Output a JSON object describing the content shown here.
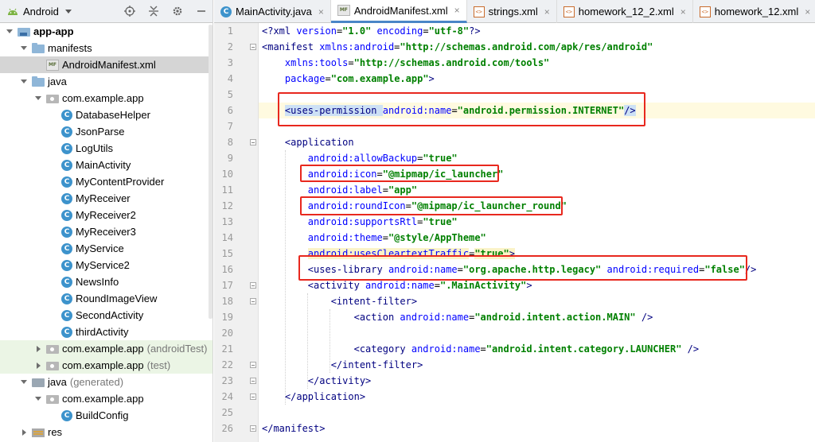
{
  "sidebar": {
    "view_label": "Android",
    "tree": [
      {
        "label": "app-app",
        "bold": true,
        "indent": 0,
        "arrow": "down",
        "icon": "module-folder-icon"
      },
      {
        "label": "manifests",
        "indent": 1,
        "arrow": "down",
        "icon": "folder-icon"
      },
      {
        "label": "AndroidManifest.xml",
        "indent": 2,
        "arrow": "none",
        "icon": "manifest-file-icon",
        "selected": true
      },
      {
        "label": "java",
        "indent": 1,
        "arrow": "down",
        "icon": "folder-icon"
      },
      {
        "label": "com.example.app",
        "indent": 2,
        "arrow": "down",
        "icon": "package-icon"
      },
      {
        "label": "DatabaseHelper",
        "indent": 3,
        "arrow": "none",
        "icon": "class-icon"
      },
      {
        "label": "JsonParse",
        "indent": 3,
        "arrow": "none",
        "icon": "class-icon"
      },
      {
        "label": "LogUtils",
        "indent": 3,
        "arrow": "none",
        "icon": "class-icon"
      },
      {
        "label": "MainActivity",
        "indent": 3,
        "arrow": "none",
        "icon": "class-icon"
      },
      {
        "label": "MyContentProvider",
        "indent": 3,
        "arrow": "none",
        "icon": "class-icon"
      },
      {
        "label": "MyReceiver",
        "indent": 3,
        "arrow": "none",
        "icon": "class-icon"
      },
      {
        "label": "MyReceiver2",
        "indent": 3,
        "arrow": "none",
        "icon": "class-icon"
      },
      {
        "label": "MyReceiver3",
        "indent": 3,
        "arrow": "none",
        "icon": "class-icon"
      },
      {
        "label": "MyService",
        "indent": 3,
        "arrow": "none",
        "icon": "class-icon"
      },
      {
        "label": "MyService2",
        "indent": 3,
        "arrow": "none",
        "icon": "class-icon"
      },
      {
        "label": "NewsInfo",
        "indent": 3,
        "arrow": "none",
        "icon": "class-icon"
      },
      {
        "label": "RoundImageView",
        "indent": 3,
        "arrow": "none",
        "icon": "class-icon"
      },
      {
        "label": "SecondActivity",
        "indent": 3,
        "arrow": "none",
        "icon": "class-icon"
      },
      {
        "label": "thirdActivity",
        "indent": 3,
        "arrow": "none",
        "icon": "class-icon"
      },
      {
        "label": "com.example.app",
        "suffix": "(androidTest)",
        "indent": 2,
        "arrow": "right",
        "icon": "package-icon",
        "green": true
      },
      {
        "label": "com.example.app",
        "suffix": "(test)",
        "indent": 2,
        "arrow": "right",
        "icon": "package-icon",
        "green": true
      },
      {
        "label": "java",
        "suffix": "(generated)",
        "indent": 1,
        "arrow": "down",
        "icon": "generated-folder-icon"
      },
      {
        "label": "com.example.app",
        "indent": 2,
        "arrow": "down",
        "icon": "package-icon"
      },
      {
        "label": "BuildConfig",
        "indent": 3,
        "arrow": "none",
        "icon": "class-icon"
      },
      {
        "label": "res",
        "indent": 1,
        "arrow": "right",
        "icon": "res-folder-icon"
      }
    ]
  },
  "tabs": [
    {
      "label": "MainActivity.java",
      "icon": "class-icon",
      "active": false
    },
    {
      "label": "AndroidManifest.xml",
      "icon": "manifest-file-icon",
      "active": true
    },
    {
      "label": "strings.xml",
      "icon": "xml-file-icon",
      "active": false
    },
    {
      "label": "homework_12_2.xml",
      "icon": "xml-file-icon",
      "active": false
    },
    {
      "label": "homework_12.xml",
      "icon": "xml-file-icon",
      "active": false
    }
  ],
  "editor": {
    "lines": [
      {
        "n": "1",
        "segs": [
          [
            "t",
            "<?xml "
          ],
          [
            "a",
            "version"
          ],
          [
            "p",
            "="
          ],
          [
            "v",
            "\"1.0\""
          ],
          [
            "p",
            " "
          ],
          [
            "a",
            "encoding"
          ],
          [
            "p",
            "="
          ],
          [
            "v",
            "\"utf-8\""
          ],
          [
            "t",
            "?>"
          ]
        ]
      },
      {
        "n": "2",
        "segs": [
          [
            "t",
            "<manifest "
          ],
          [
            "a",
            "xmlns:android"
          ],
          [
            "p",
            "="
          ],
          [
            "v",
            "\"http://schemas.android.com/apk/res/android\""
          ]
        ]
      },
      {
        "n": "3",
        "segs": [
          [
            "p",
            "    "
          ],
          [
            "a",
            "xmlns:tools"
          ],
          [
            "p",
            "="
          ],
          [
            "v",
            "\"http://schemas.android.com/tools\""
          ]
        ]
      },
      {
        "n": "4",
        "segs": [
          [
            "p",
            "    "
          ],
          [
            "a",
            "package"
          ],
          [
            "p",
            "="
          ],
          [
            "v",
            "\"com.example.app\""
          ],
          [
            "t",
            ">"
          ]
        ]
      },
      {
        "n": "5",
        "segs": []
      },
      {
        "n": "6",
        "segs": [
          [
            "p",
            "    "
          ],
          [
            "t",
            "<uses-permission "
          ],
          [
            "a",
            "android:name"
          ],
          [
            "p",
            "="
          ],
          [
            "v",
            "\"android.permission.INTERNET\""
          ],
          [
            "t",
            "/>"
          ]
        ]
      },
      {
        "n": "7",
        "segs": []
      },
      {
        "n": "8",
        "segs": [
          [
            "p",
            "    "
          ],
          [
            "t",
            "<application"
          ]
        ]
      },
      {
        "n": "9",
        "segs": [
          [
            "p",
            "        "
          ],
          [
            "a",
            "android:allowBackup"
          ],
          [
            "p",
            "="
          ],
          [
            "v",
            "\"true\""
          ]
        ]
      },
      {
        "n": "10",
        "segs": [
          [
            "p",
            "        "
          ],
          [
            "a",
            "android:icon"
          ],
          [
            "p",
            "="
          ],
          [
            "v",
            "\"@mipmap/ic_launcher\""
          ]
        ]
      },
      {
        "n": "11",
        "segs": [
          [
            "p",
            "        "
          ],
          [
            "a",
            "android:label"
          ],
          [
            "p",
            "="
          ],
          [
            "v",
            "\"app\""
          ]
        ]
      },
      {
        "n": "12",
        "segs": [
          [
            "p",
            "        "
          ],
          [
            "a",
            "android:roundIcon"
          ],
          [
            "p",
            "="
          ],
          [
            "v",
            "\"@mipmap/ic_launcher_round\""
          ]
        ]
      },
      {
        "n": "13",
        "segs": [
          [
            "p",
            "        "
          ],
          [
            "a",
            "android:supportsRtl"
          ],
          [
            "p",
            "="
          ],
          [
            "v",
            "\"true\""
          ]
        ]
      },
      {
        "n": "14",
        "segs": [
          [
            "p",
            "        "
          ],
          [
            "a",
            "android:theme"
          ],
          [
            "p",
            "="
          ],
          [
            "v",
            "\"@style/AppTheme\""
          ]
        ]
      },
      {
        "n": "15",
        "segs": [
          [
            "p",
            "        "
          ],
          [
            "a",
            "android:usesCleartextTraffic"
          ],
          [
            "p",
            "="
          ],
          [
            "v",
            "\"true\""
          ],
          [
            "t",
            ">"
          ]
        ]
      },
      {
        "n": "16",
        "segs": [
          [
            "p",
            "        "
          ],
          [
            "t",
            "<uses-library "
          ],
          [
            "a",
            "android:name"
          ],
          [
            "p",
            "="
          ],
          [
            "v",
            "\"org.apache.http.legacy\""
          ],
          [
            "p",
            " "
          ],
          [
            "a",
            "android:required"
          ],
          [
            "p",
            "="
          ],
          [
            "v",
            "\"false\""
          ],
          [
            "t",
            "/>"
          ]
        ]
      },
      {
        "n": "17",
        "segs": [
          [
            "p",
            "        "
          ],
          [
            "t",
            "<activity "
          ],
          [
            "a",
            "android:name"
          ],
          [
            "p",
            "="
          ],
          [
            "v",
            "\".MainActivity\""
          ],
          [
            "t",
            ">"
          ]
        ]
      },
      {
        "n": "18",
        "segs": [
          [
            "p",
            "            "
          ],
          [
            "t",
            "<intent-filter>"
          ]
        ]
      },
      {
        "n": "19",
        "segs": [
          [
            "p",
            "                "
          ],
          [
            "t",
            "<action "
          ],
          [
            "a",
            "android:name"
          ],
          [
            "p",
            "="
          ],
          [
            "v",
            "\"android.intent.action.MAIN\""
          ],
          [
            "t",
            " />"
          ]
        ]
      },
      {
        "n": "20",
        "segs": []
      },
      {
        "n": "21",
        "segs": [
          [
            "p",
            "                "
          ],
          [
            "t",
            "<category "
          ],
          [
            "a",
            "android:name"
          ],
          [
            "p",
            "="
          ],
          [
            "v",
            "\"android.intent.category.LAUNCHER\""
          ],
          [
            "t",
            " />"
          ]
        ]
      },
      {
        "n": "22",
        "segs": [
          [
            "p",
            "            "
          ],
          [
            "t",
            "</intent-filter>"
          ]
        ]
      },
      {
        "n": "23",
        "segs": [
          [
            "p",
            "        "
          ],
          [
            "t",
            "</activity>"
          ]
        ]
      },
      {
        "n": "24",
        "segs": [
          [
            "p",
            "    "
          ],
          [
            "t",
            "</application>"
          ]
        ]
      },
      {
        "n": "25",
        "segs": []
      },
      {
        "n": "26",
        "segs": [
          [
            "t",
            "</manifest>"
          ]
        ]
      }
    ]
  },
  "colors": {
    "tag": "#000080",
    "attribute": "#0000ff",
    "value": "#008000",
    "annotation_box": "#e8281e",
    "selection": "#d5d5d5",
    "tab_underline": "#4a86c7"
  }
}
